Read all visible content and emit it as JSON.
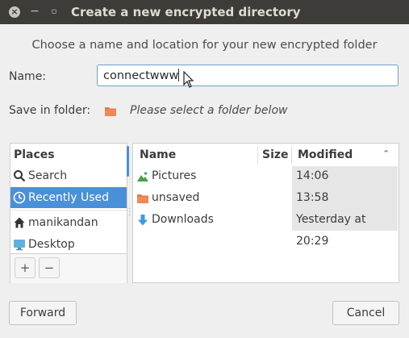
{
  "window": {
    "title": "Create a new encrypted directory",
    "close_glyph": "×",
    "minimize_glyph": "−",
    "maximize_glyph": "▫"
  },
  "dialog": {
    "subtitle": "Choose a name and location for your new encrypted folder",
    "name_label": "Name:",
    "name_value": "connectwww",
    "save_in_label": "Save in folder:",
    "save_in_hint": "Please select a folder below"
  },
  "places": {
    "header": "Places",
    "items": [
      {
        "label": "Search",
        "icon": "search-icon"
      },
      {
        "label": "Recently Used",
        "icon": "clock-icon",
        "selected": true
      },
      {
        "label": "manikandan",
        "icon": "home-icon"
      },
      {
        "label": "Desktop",
        "icon": "desktop-icon"
      }
    ],
    "add_glyph": "+",
    "remove_glyph": "−"
  },
  "files": {
    "columns": {
      "name": "Name",
      "size": "Size",
      "modified": "Modified"
    },
    "sort_glyph": "⌃",
    "rows": [
      {
        "name": "Pictures",
        "modified": "14:06",
        "icon": "pictures-folder-icon",
        "size": ""
      },
      {
        "name": "unsaved",
        "modified": "13:58",
        "icon": "folder-icon",
        "size": ""
      },
      {
        "name": "Downloads",
        "modified": "Yesterday at 20:29",
        "icon": "download-icon",
        "size": ""
      }
    ]
  },
  "buttons": {
    "forward": "Forward",
    "cancel": "Cancel"
  },
  "colors": {
    "accent": "#4a90d9",
    "folder": "#e67c4a",
    "titlebar": "#3d3c38"
  }
}
